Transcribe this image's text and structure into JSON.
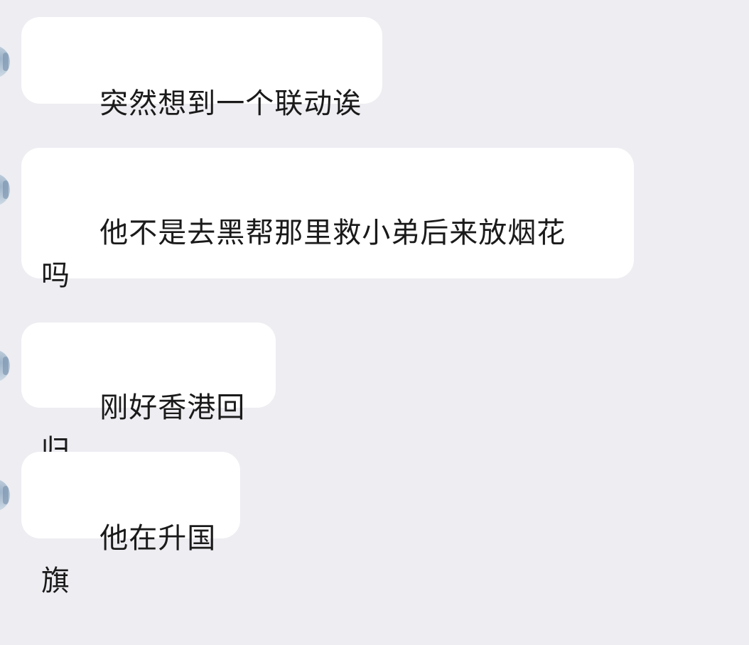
{
  "messages": [
    {
      "text": "突然想到一个联动诶"
    },
    {
      "text": "他不是去黑帮那里救小弟后来放烟花\n吗"
    },
    {
      "text": "刚好香港回归"
    },
    {
      "text": "他在升国旗"
    }
  ],
  "colors": {
    "background": "#ededf2",
    "bubble": "#ffffff",
    "text": "#1a1a1a"
  }
}
